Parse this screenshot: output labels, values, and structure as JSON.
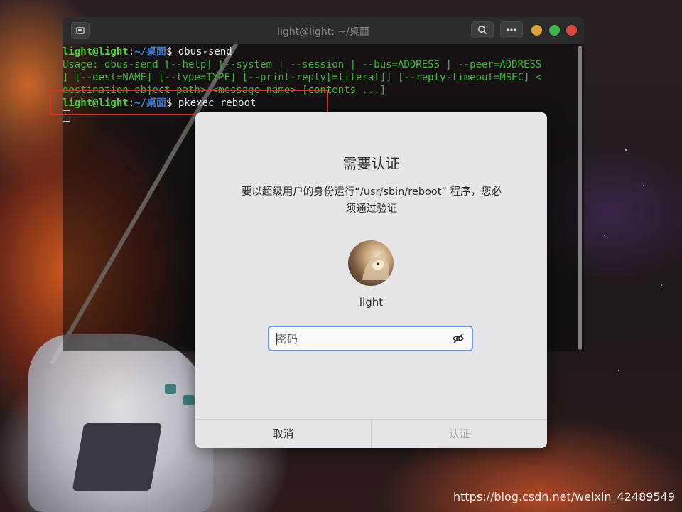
{
  "terminal": {
    "title": "light@light: ~/桌面",
    "lines": [
      {
        "user": "light@light",
        "path": "~/桌面",
        "dollar": "$",
        "cmd": " dbus-send"
      },
      {
        "text": "Usage: dbus-send [--help] [--system | --session | --bus=ADDRESS | --peer=ADDRESS"
      },
      {
        "text": "] [--dest=NAME] [--type=TYPE] [--print-reply[=literal]] [--reply-timeout=MSEC] <"
      },
      {
        "text": "destination object path> <message name> [contents ...]"
      },
      {
        "user": "light@light",
        "path": "~/桌面",
        "dollar": "$",
        "cmd": " pkexec reboot"
      }
    ]
  },
  "dialog": {
    "title": "需要认证",
    "message": "要以超级用户的身份运行“/usr/sbin/reboot” 程序，您必须通过验证",
    "username": "light",
    "password_placeholder": "密码",
    "cancel_label": "取消",
    "auth_label": "认证"
  },
  "watermark": "https://blog.csdn.net/weixin_42489549",
  "colors": {
    "dialog_bg": "#e6e6e8",
    "input_focus": "#6f9be6",
    "terminal_green": "#3fb83a",
    "prompt_path": "#3f7fd8",
    "highlight_box": "#e0302d"
  }
}
